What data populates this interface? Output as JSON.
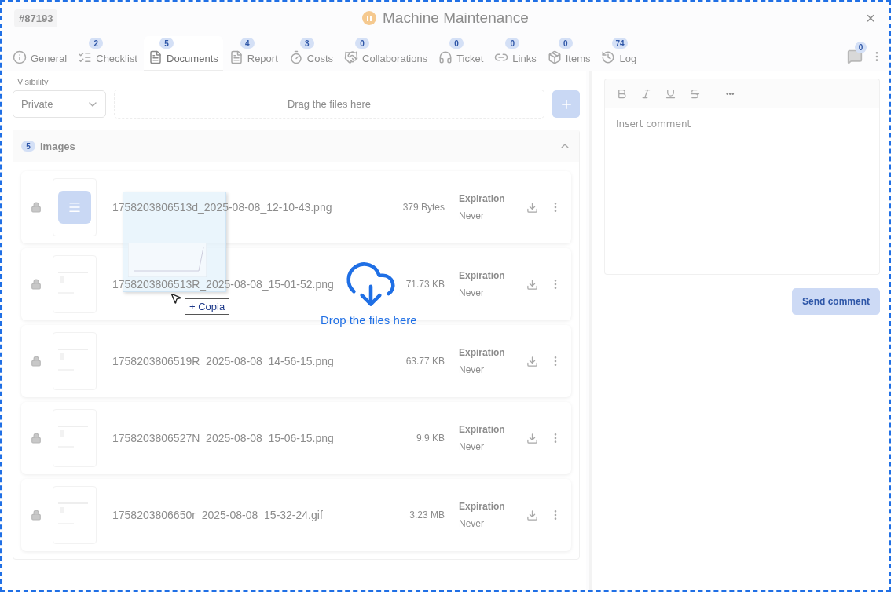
{
  "header": {
    "id": "#87193",
    "title": "Machine Maintenance",
    "close": "×"
  },
  "tabs": [
    {
      "label": "General",
      "selected": false
    },
    {
      "label": "Checklist",
      "badge": "2",
      "selected": false
    },
    {
      "label": "Documents",
      "badge": "5",
      "selected": true
    },
    {
      "label": "Report",
      "badge": "4",
      "selected": false
    },
    {
      "label": "Costs",
      "badge": "3",
      "selected": false
    },
    {
      "label": "Collaborations",
      "badge": "0",
      "selected": false
    },
    {
      "label": "Ticket",
      "badge": "0",
      "selected": false
    },
    {
      "label": "Links",
      "badge": "0",
      "selected": false
    },
    {
      "label": "Items",
      "badge": "0",
      "selected": false
    },
    {
      "label": "Log",
      "badge": "74",
      "selected": false
    }
  ],
  "chat_badge": "0",
  "visibility": {
    "label": "Visibility",
    "value": "Private"
  },
  "dropzone": {
    "text": "Drag the files here"
  },
  "section": {
    "count": "5",
    "title": "Images",
    "expanded": true
  },
  "files": [
    {
      "kind": "document",
      "name": "1758203806513d_2025-08-08_12-10-43.png",
      "size": "379 Bytes",
      "expiration_label": "Expiration",
      "expiration": "Never"
    },
    {
      "kind": "picture",
      "name": "1758203806513R_2025-08-08_15-01-52.png",
      "size": "71.73 KB",
      "expiration_label": "Expiration",
      "expiration": "Never"
    },
    {
      "kind": "picture",
      "name": "1758203806519R_2025-08-08_14-56-15.png",
      "size": "63.77 KB",
      "expiration_label": "Expiration",
      "expiration": "Never"
    },
    {
      "kind": "picture",
      "name": "1758203806527N_2025-08-08_15-06-15.png",
      "size": "9.9 KB",
      "expiration_label": "Expiration",
      "expiration": "Never"
    },
    {
      "kind": "picture",
      "name": "1758203806650r_2025-08-08_15-32-24.gif",
      "size": "3.23 MB",
      "expiration_label": "Expiration",
      "expiration": "Never"
    }
  ],
  "editor": {
    "placeholder": "Insert comment",
    "more": "•••"
  },
  "send_button": "Send comment",
  "drag": {
    "badge": "+ Copia"
  },
  "drop_overlay": {
    "text": "Drop the files here"
  }
}
